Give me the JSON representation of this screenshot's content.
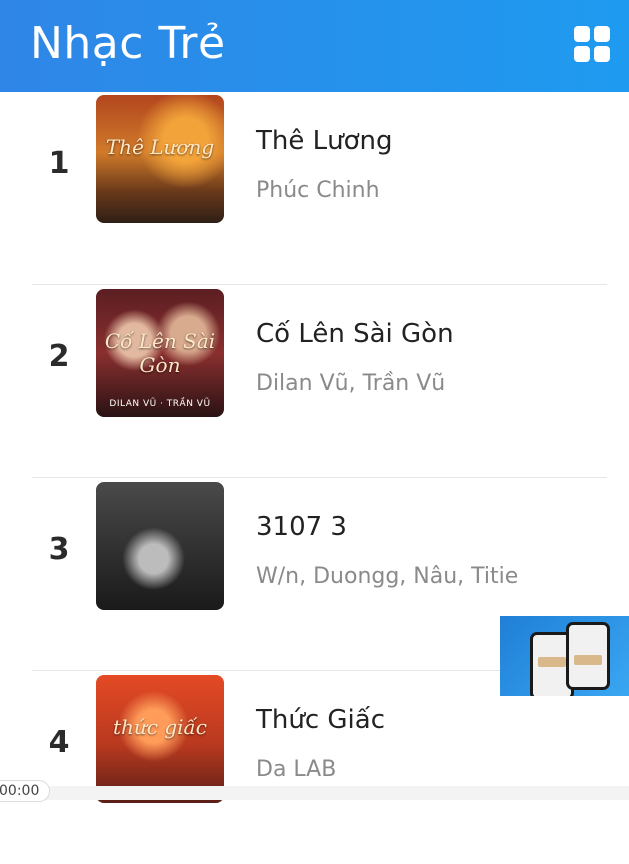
{
  "header": {
    "title": "Nhạc Trẻ",
    "menu_icon": "grid-icon"
  },
  "colors": {
    "header_start": "#2f86e6",
    "header_end": "#1e9bf0",
    "song_title": "#222222",
    "artist": "#8a8a8a"
  },
  "songs": [
    {
      "rank": "1",
      "title": "Thê Lương",
      "artist": "Phúc Chinh",
      "cover_text": "Thê Lương",
      "cover_sub": ""
    },
    {
      "rank": "2",
      "title": "Cố Lên Sài Gòn",
      "artist": "Dilan Vũ, Trần Vũ",
      "cover_text": "Cố Lên Sài Gòn",
      "cover_sub": "DILAN VŨ · TRẦN VŨ"
    },
    {
      "rank": "3",
      "title": "3107 3",
      "artist": "W/n, Duongg, Nâu, Titie",
      "cover_text": "",
      "cover_sub": ""
    },
    {
      "rank": "4",
      "title": "Thức Giấc",
      "artist": "Da LAB",
      "cover_text": "thức giấc",
      "cover_sub": ""
    }
  ],
  "player": {
    "time": "00:00"
  }
}
